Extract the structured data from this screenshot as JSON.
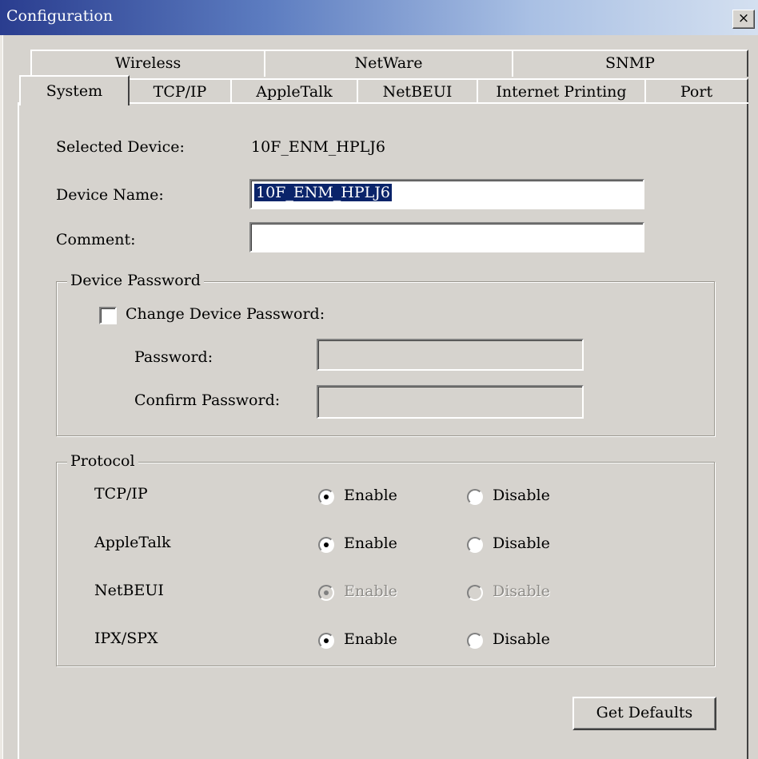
{
  "window": {
    "title": "Configuration",
    "close_glyph": "×"
  },
  "tabs": {
    "row1": [
      "Wireless",
      "NetWare",
      "SNMP"
    ],
    "row2": [
      "System",
      "TCP/IP",
      "AppleTalk",
      "NetBEUI",
      "Internet Printing",
      "Port"
    ],
    "selected": "System"
  },
  "system": {
    "selected_device_label": "Selected Device:",
    "selected_device_value": "10F_ENM_HPLJ6",
    "device_name_label": "Device Name:",
    "device_name_value": "10F_ENM_HPLJ6",
    "comment_label": "Comment:",
    "comment_value": ""
  },
  "device_password": {
    "group_title": "Device Password",
    "change_label": "Change Device Password:",
    "change_checked": false,
    "password_label": "Password:",
    "confirm_label": "Confirm Password:"
  },
  "protocol": {
    "group_title": "Protocol",
    "enable_label": "Enable",
    "disable_label": "Disable",
    "rows": [
      {
        "name": "TCP/IP",
        "enabled": true,
        "disabled_control": false
      },
      {
        "name": "AppleTalk",
        "enabled": true,
        "disabled_control": false
      },
      {
        "name": "NetBEUI",
        "enabled": true,
        "disabled_control": true
      },
      {
        "name": "IPX/SPX",
        "enabled": true,
        "disabled_control": false
      }
    ]
  },
  "buttons": {
    "get_defaults": "Get Defaults"
  }
}
